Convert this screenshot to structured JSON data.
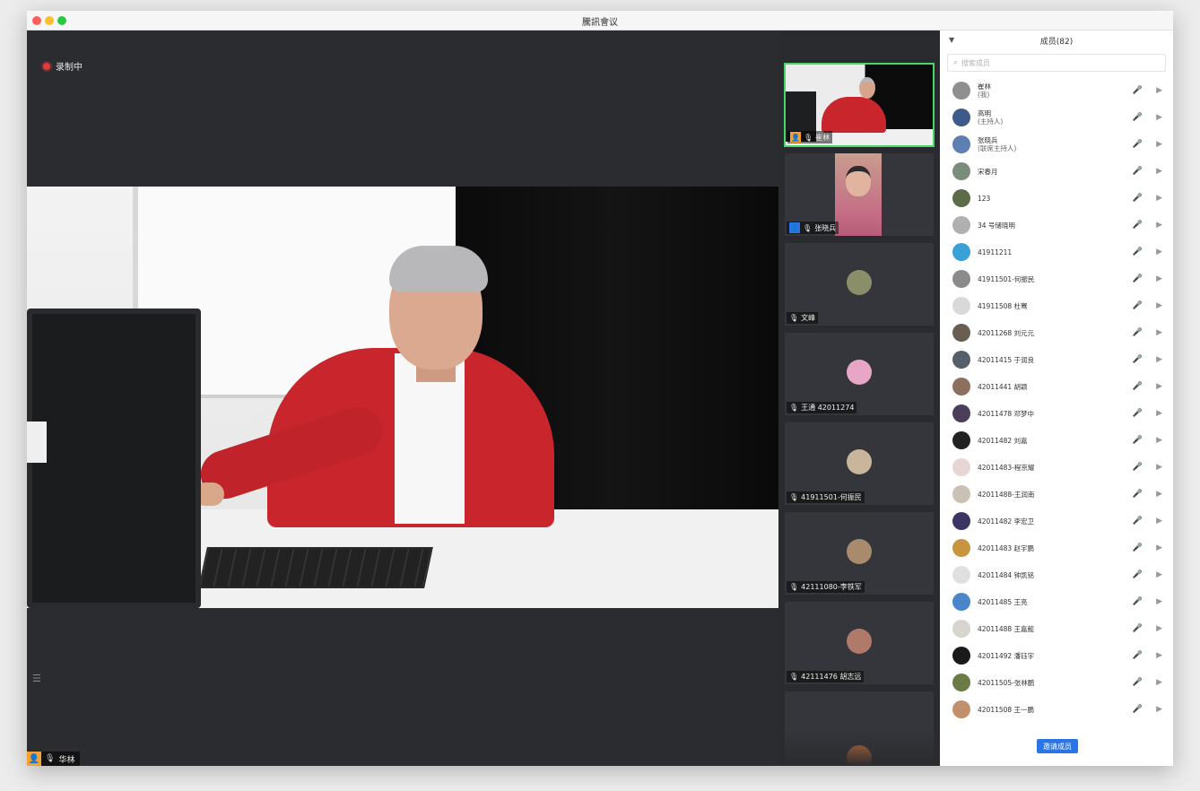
{
  "window": {
    "title": "騰訊會议"
  },
  "main_stage": {
    "recording_label": "录制中",
    "speaker_name": "华林"
  },
  "video_strip": {
    "tiles": [
      {
        "name": "崔林",
        "badge": "host",
        "color": "#f4a22d"
      },
      {
        "name": "张晓兵",
        "badge": "cohost",
        "color": "#2a75e6"
      },
      {
        "name": "文峰",
        "avatar_color": "#8a8f6a"
      },
      {
        "name": "王通 42011274",
        "avatar_color": "#e7a6c6"
      },
      {
        "name": "41911501-何振民",
        "avatar_color": "#c9b59b"
      },
      {
        "name": "42111080-李铁军",
        "avatar_color": "#a88b6d"
      },
      {
        "name": "42111476 胡志远",
        "avatar_color": "#b07a6b"
      },
      {
        "name": "",
        "avatar_color": "#d2773d"
      }
    ]
  },
  "participants_panel": {
    "title": "成员(82)",
    "search_placeholder": "搜索成员",
    "members": [
      {
        "name": "崔林",
        "sub": "(我)",
        "avatar": "#8f8f8f",
        "mic_live": false
      },
      {
        "name": "高明",
        "sub": "(主持人)",
        "avatar": "#3d5a8a",
        "mic_live": false
      },
      {
        "name": "张晓兵",
        "sub": "(联席主持人)",
        "avatar": "#5d7fb1",
        "mic_live": false
      },
      {
        "name": "宋春月",
        "sub": "",
        "avatar": "#7c8c7a",
        "mic_live": true
      },
      {
        "name": "123",
        "sub": "",
        "avatar": "#5e6b48",
        "mic_live": false
      },
      {
        "name": "34 号储晓明",
        "sub": "",
        "avatar": "#b0b0b0",
        "mic_live": false
      },
      {
        "name": "41911211",
        "sub": "",
        "avatar": "#3aa0d8",
        "mic_live": false
      },
      {
        "name": "41911501-何振民",
        "sub": "",
        "avatar": "#8b8b8b",
        "mic_live": false
      },
      {
        "name": "41911508 杜骞",
        "sub": "",
        "avatar": "#d9d9d9",
        "mic_live": false
      },
      {
        "name": "42011268 刘元元",
        "sub": "",
        "avatar": "#6a5e52",
        "mic_live": false
      },
      {
        "name": "42011415 于润良",
        "sub": "",
        "avatar": "#55606b",
        "mic_live": false
      },
      {
        "name": "42011441 胡颖",
        "sub": "",
        "avatar": "#8d6f5e",
        "mic_live": false
      },
      {
        "name": "42011478 邓梦中",
        "sub": "",
        "avatar": "#4b3e58",
        "mic_live": false
      },
      {
        "name": "42011482 刘嘉",
        "sub": "",
        "avatar": "#222222",
        "mic_live": false
      },
      {
        "name": "42011483-程京耀",
        "sub": "",
        "avatar": "#e8d6d6",
        "mic_live": false
      },
      {
        "name": "42011488-王润南",
        "sub": "",
        "avatar": "#c9c2b5",
        "mic_live": false
      },
      {
        "name": "42011482 李宏卫",
        "sub": "",
        "avatar": "#3b3566",
        "mic_live": false
      },
      {
        "name": "42011483 赵宇鹏",
        "sub": "",
        "avatar": "#c7953f",
        "mic_live": false
      },
      {
        "name": "42011484 钟凯铭",
        "sub": "",
        "avatar": "#e0e0e0",
        "mic_live": false
      },
      {
        "name": "42011485 王亮",
        "sub": "",
        "avatar": "#4a86c9",
        "mic_live": false
      },
      {
        "name": "42011488 王嘉懿",
        "sub": "",
        "avatar": "#d8d4cf",
        "mic_live": false
      },
      {
        "name": "42011492 潘钰宇",
        "sub": "",
        "avatar": "#1a1a1a",
        "mic_live": false
      },
      {
        "name": "42011505-张林鹏",
        "sub": "",
        "avatar": "#6c7a45",
        "mic_live": false
      },
      {
        "name": "42011508 王一鹏",
        "sub": "",
        "avatar": "#c18f6b",
        "mic_live": false
      }
    ],
    "invite_label": "邀请成员"
  },
  "icons": {
    "mic": "🎙",
    "mic_muted": "🎤",
    "camera": "▶"
  },
  "colors": {
    "recording": "#e03c3c",
    "active_tile_border": "#4bd66a",
    "invite_button": "#2a75e6",
    "host_badge": "#f4a22d"
  }
}
